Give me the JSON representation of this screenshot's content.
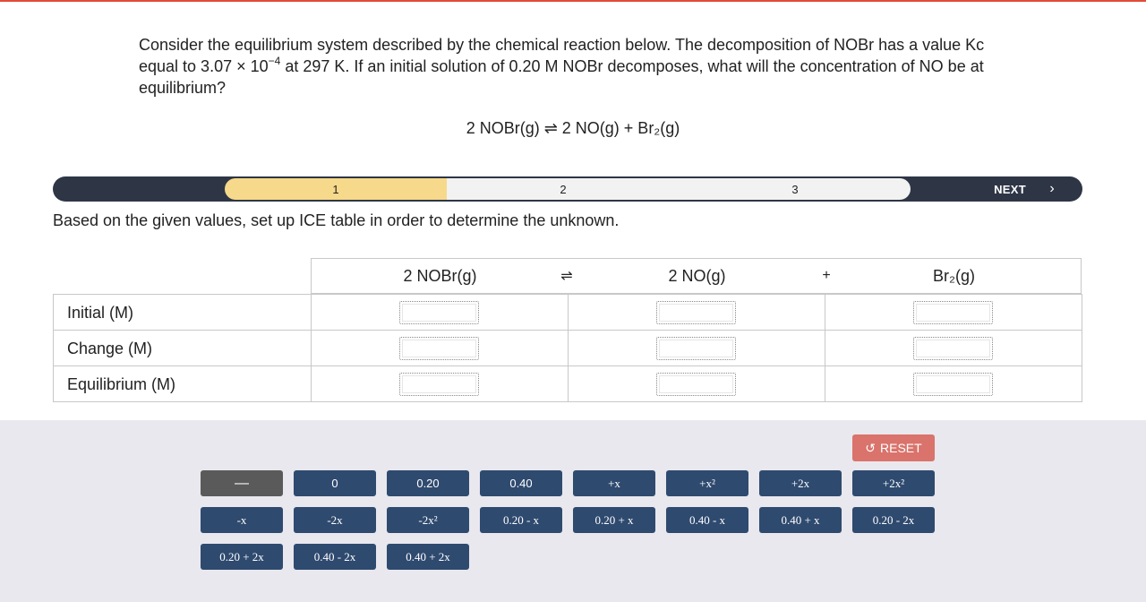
{
  "question": {
    "text_before": "Consider the equilibrium system described by the chemical reaction below. The decomposition of NOBr has a value Kc equal to 3.07 × 10",
    "exponent": "−4",
    "text_after": " at 297 K. If an initial solution of 0.20 M NOBr decomposes, what will the concentration of NO be at equilibrium?"
  },
  "equation": "2 NOBr(g) ⇌ 2 NO(g) + Br₂(g)",
  "steps": {
    "labels": [
      "1",
      "2",
      "3"
    ],
    "active": "1",
    "next_label": "NEXT",
    "next_icon": "chevron-right-icon"
  },
  "instruction": "Based on the given values, set up ICE table in order to determine the unknown.",
  "ice_table": {
    "headers": {
      "reactant": "2 NOBr(g)",
      "arrow": "⇌",
      "product1": "2 NO(g)",
      "plus": "+",
      "product2": "Br₂(g)"
    },
    "rows": [
      "Initial (M)",
      "Change (M)",
      "Equilibrium (M)"
    ]
  },
  "tray": {
    "reset_label": "RESET",
    "reset_icon": "undo-icon",
    "tiles": [
      "—",
      "0",
      "0.20",
      "0.40",
      "+x",
      "+x²",
      "+2x",
      "+2x²",
      "-x",
      "-2x",
      "-2x²",
      "0.20 - x",
      "0.20 + x",
      "0.40 - x",
      "0.40 + x",
      "0.20 - 2x",
      "0.20 + 2x",
      "0.40 - 2x",
      "0.40 + 2x"
    ]
  },
  "colors": {
    "step_active": "#f6d98a",
    "bar_dark": "#2e3646",
    "tile": "#2f4a6f",
    "reset": "#d9736b",
    "tray_bg": "#e9e8ee"
  }
}
